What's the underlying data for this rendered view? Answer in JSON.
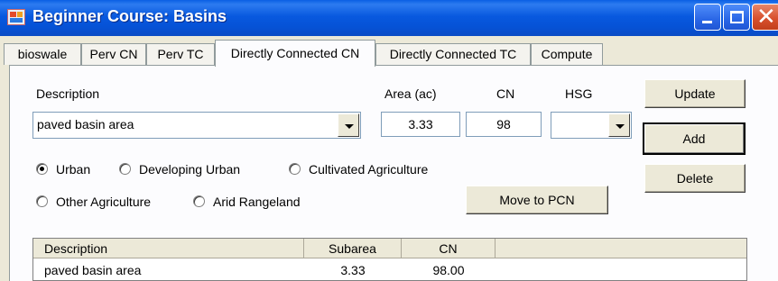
{
  "window": {
    "title": "Beginner Course: Basins",
    "icon": "app-grid-icon",
    "controls": {
      "minimize": "minimize-icon",
      "maximize": "maximize-icon",
      "close": "close-icon"
    },
    "accent": "#0a5fe4"
  },
  "tabs": [
    {
      "label": "bioswale",
      "active": false
    },
    {
      "label": "Perv CN",
      "active": false
    },
    {
      "label": "Perv TC",
      "active": false
    },
    {
      "label": "Directly Connected CN",
      "active": true
    },
    {
      "label": "Directly Connected TC",
      "active": false
    },
    {
      "label": "Compute",
      "active": false
    }
  ],
  "form": {
    "description_label": "Description",
    "description_value": "paved basin area",
    "area_label": "Area (ac)",
    "area_value": "3.33",
    "cn_label": "CN",
    "cn_value": "98",
    "hsg_label": "HSG",
    "hsg_value": ""
  },
  "buttons": {
    "update": "Update",
    "add": "Add",
    "delete": "Delete",
    "move_to_pcn": "Move to PCN"
  },
  "land_use": {
    "selected": "Urban",
    "options": [
      "Urban",
      "Developing Urban",
      "Cultivated Agriculture",
      "Other Agriculture",
      "Arid Rangeland"
    ]
  },
  "table": {
    "columns": [
      "Description",
      "Subarea",
      "CN",
      ""
    ],
    "rows": [
      [
        "paved basin area",
        "3.33",
        "98.00",
        ""
      ]
    ]
  }
}
